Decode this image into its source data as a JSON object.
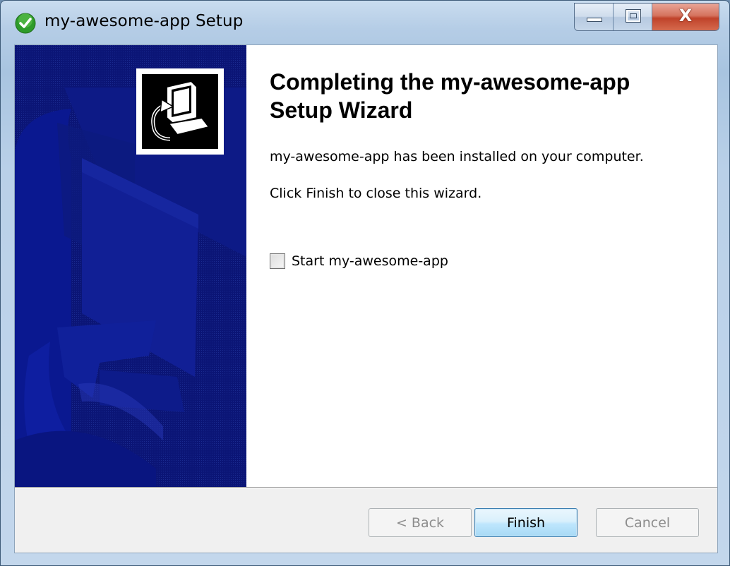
{
  "window": {
    "title": "my-awesome-app Setup",
    "title_icon": "green-check-shield-icon",
    "caption": {
      "minimize_icon": "minimize-icon",
      "maximize_icon": "maximize-icon",
      "close_icon": "close-icon",
      "close_glyph": "X"
    }
  },
  "banner": {
    "icon": "computer-install-icon",
    "background_color": "#0b1576"
  },
  "content": {
    "heading_line1": "Completing the my-awesome-app",
    "heading_line2": "Setup Wizard",
    "installed_text": "my-awesome-app has been installed on your computer.",
    "finish_hint": "Click Finish to close this wizard.",
    "launch_checkbox": {
      "label": "Start my-awesome-app",
      "checked": false
    }
  },
  "buttons": {
    "back": "< Back",
    "finish": "Finish",
    "cancel": "Cancel"
  }
}
